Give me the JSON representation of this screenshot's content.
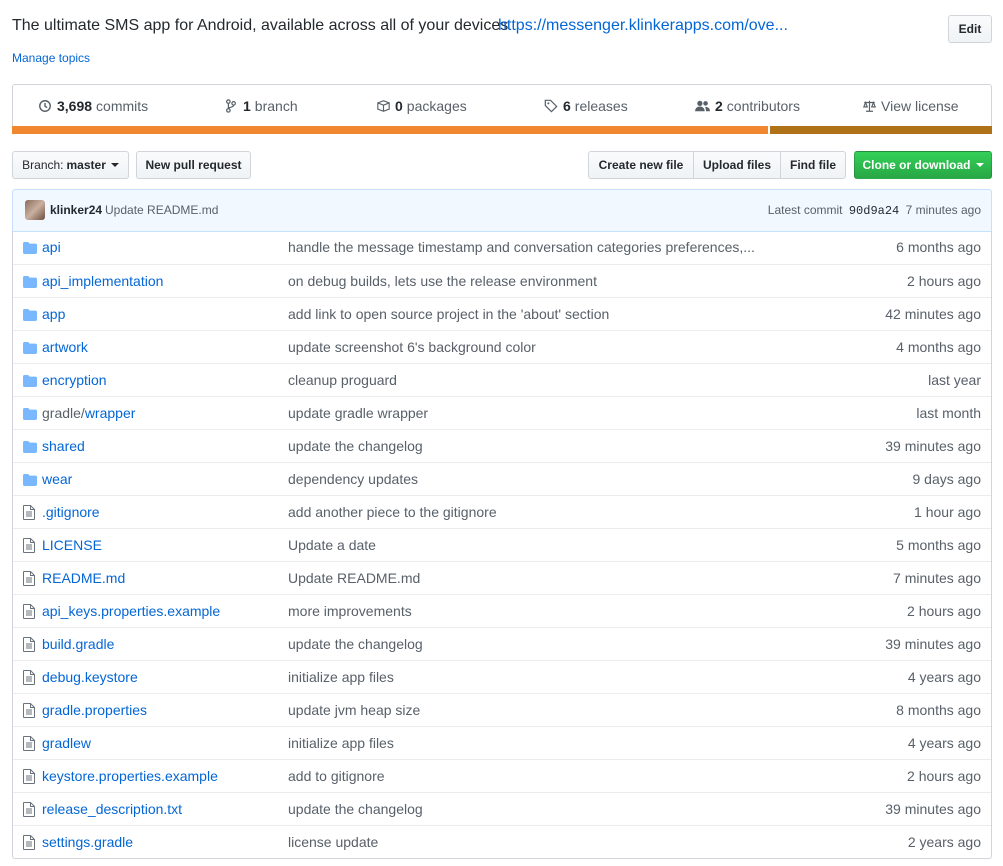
{
  "repo": {
    "description": "The ultimate SMS app for Android, available across all of your devices",
    "website": "https://messenger.klinkerapps.com/ove...",
    "edit_label": "Edit",
    "manage_topics": "Manage topics"
  },
  "summary": {
    "commits": {
      "count": "3,698",
      "label": "commits",
      "icon": "history-icon"
    },
    "branches": {
      "count": "1",
      "label": "branch",
      "icon": "git-branch-icon"
    },
    "packages": {
      "count": "0",
      "label": "packages",
      "icon": "package-icon"
    },
    "releases": {
      "count": "6",
      "label": "releases",
      "icon": "tag-icon"
    },
    "contributors": {
      "count": "2",
      "label": "contributors",
      "icon": "people-icon"
    },
    "license": {
      "label": "View license",
      "icon": "law-icon"
    },
    "languages": [
      {
        "color": "#f1882f",
        "share": 0.772
      },
      {
        "color": "#b07219",
        "share": 0.228
      }
    ]
  },
  "toolbar": {
    "branch_prefix": "Branch:",
    "branch_name": "master",
    "new_pr": "New pull request",
    "create_file": "Create new file",
    "upload_files": "Upload files",
    "find_file": "Find file",
    "clone": "Clone or download"
  },
  "latest_commit": {
    "author": "klinker24",
    "message": "Update README.md",
    "label": "Latest commit",
    "sha": "90d9a24",
    "age": "7 minutes ago"
  },
  "files": [
    {
      "type": "dir",
      "name": "api",
      "message": "handle the message timestamp and conversation categories preferences,...",
      "age": "6 months ago"
    },
    {
      "type": "dir",
      "name": "api_implementation",
      "message": "on debug builds, lets use the release environment",
      "age": "2 hours ago"
    },
    {
      "type": "dir",
      "name": "app",
      "message": "add link to open source project in the 'about' section",
      "age": "42 minutes ago"
    },
    {
      "type": "dir",
      "name": "artwork",
      "message": "update screenshot 6's background color",
      "age": "4 months ago"
    },
    {
      "type": "dir",
      "name": "encryption",
      "message": "cleanup proguard",
      "age": "last year"
    },
    {
      "type": "dir",
      "prefix": "gradle/",
      "name": "wrapper",
      "message": "update gradle wrapper",
      "age": "last month"
    },
    {
      "type": "dir",
      "name": "shared",
      "message": "update the changelog",
      "age": "39 minutes ago"
    },
    {
      "type": "dir",
      "name": "wear",
      "message": "dependency updates",
      "age": "9 days ago"
    },
    {
      "type": "file",
      "name": ".gitignore",
      "message": "add another piece to the gitignore",
      "age": "1 hour ago"
    },
    {
      "type": "file",
      "name": "LICENSE",
      "message": "Update a date",
      "age": "5 months ago"
    },
    {
      "type": "file",
      "name": "README.md",
      "message": "Update README.md",
      "age": "7 minutes ago"
    },
    {
      "type": "file",
      "name": "api_keys.properties.example",
      "message": "more improvements",
      "age": "2 hours ago"
    },
    {
      "type": "file",
      "name": "build.gradle",
      "message": "update the changelog",
      "age": "39 minutes ago"
    },
    {
      "type": "file",
      "name": "debug.keystore",
      "message": "initialize app files",
      "age": "4 years ago"
    },
    {
      "type": "file",
      "name": "gradle.properties",
      "message": "update jvm heap size",
      "age": "8 months ago"
    },
    {
      "type": "file",
      "name": "gradlew",
      "message": "initialize app files",
      "age": "4 years ago"
    },
    {
      "type": "file",
      "name": "keystore.properties.example",
      "message": "add to gitignore",
      "age": "2 hours ago"
    },
    {
      "type": "file",
      "name": "release_description.txt",
      "message": "update the changelog",
      "age": "39 minutes ago"
    },
    {
      "type": "file",
      "name": "settings.gradle",
      "message": "license update",
      "age": "2 years ago"
    }
  ]
}
